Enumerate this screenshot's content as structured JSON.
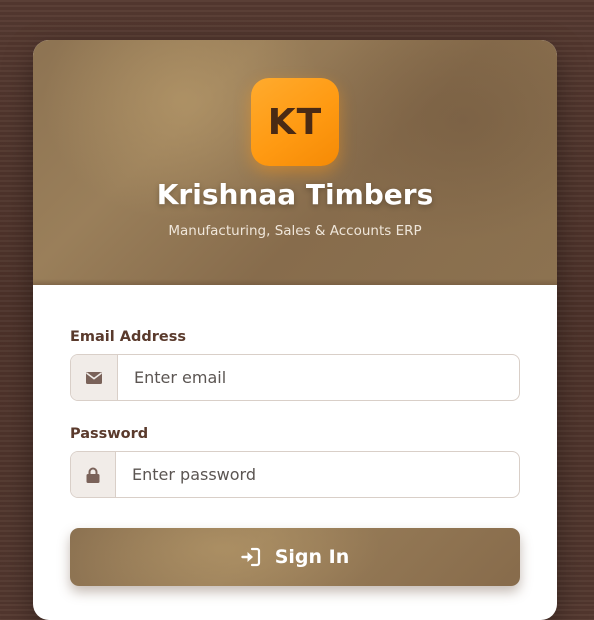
{
  "brand": {
    "logo_text": "KT",
    "title": "Krishnaa Timbers",
    "subtitle": "Manufacturing, Sales & Accounts ERP"
  },
  "form": {
    "email": {
      "label": "Email Address",
      "placeholder": "Enter email",
      "icon": "envelope-icon"
    },
    "password": {
      "label": "Password",
      "placeholder": "Enter password",
      "icon": "lock-icon"
    },
    "submit": {
      "label": "Sign In",
      "icon": "sign-in-icon"
    }
  },
  "colors": {
    "background": "#4f352c",
    "header": "#8d7352",
    "logo": "#ff9a12",
    "label": "#5a3a2c",
    "button": "#8d7352"
  }
}
